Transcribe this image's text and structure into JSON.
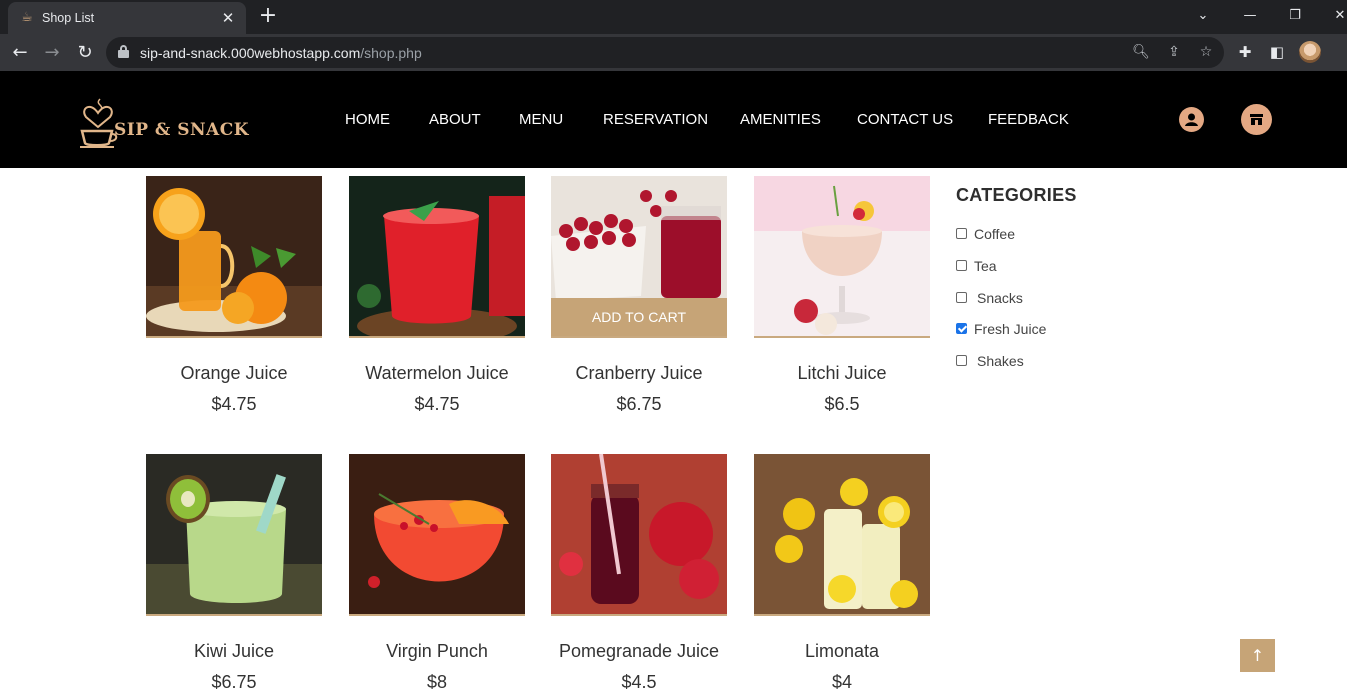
{
  "browser": {
    "tab_title": "Shop List",
    "tab_close": "✕",
    "new_tab": "+",
    "url_domain": "sip-and-snack.000webhostapp.com",
    "url_path": "/shop.php",
    "icons": [
      "back-icon",
      "forward-icon",
      "reload-icon",
      "lock-icon",
      "zoom-icon",
      "share-icon",
      "star-icon",
      "extensions-icon",
      "sidepanel-icon",
      "profile-icon"
    ]
  },
  "site": {
    "logo_text": "SIP & SNACK",
    "nav": [
      "HOME",
      "ABOUT",
      "MENU",
      "RESERVATION",
      "AMENITIES",
      "CONTACT US",
      "FEEDBACK"
    ],
    "accent_color": "#c6a477",
    "icons": [
      "user-icon",
      "shop-icon"
    ]
  },
  "products": [
    {
      "name": "Orange Juice",
      "price": "$4.75"
    },
    {
      "name": "Watermelon Juice",
      "price": "$4.75"
    },
    {
      "name": "Cranberry Juice",
      "price": "$6.75",
      "hover_button": "ADD TO CART"
    },
    {
      "name": "Litchi Juice",
      "price": "$6.5"
    },
    {
      "name": "Kiwi Juice",
      "price": "$6.75"
    },
    {
      "name": "Virgin Punch",
      "price": "$8"
    },
    {
      "name": "Pomegranade Juice",
      "price": "$4.5"
    },
    {
      "name": "Limonata",
      "price": "$4"
    }
  ],
  "categories": {
    "title": "CATEGORIES",
    "items": [
      {
        "label": "Coffee",
        "checked": false
      },
      {
        "label": "Tea",
        "checked": false
      },
      {
        "label": "Snacks",
        "checked": false
      },
      {
        "label": "Fresh Juice",
        "checked": true
      },
      {
        "label": "Shakes",
        "checked": false
      }
    ]
  },
  "back_to_top": "↑"
}
